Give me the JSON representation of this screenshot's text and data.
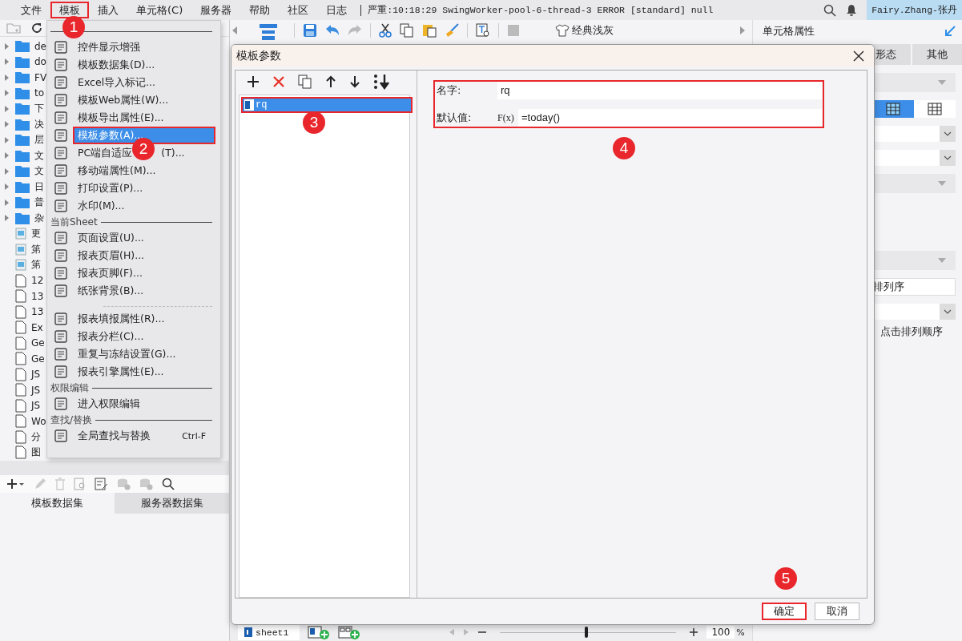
{
  "menubar": {
    "items": [
      {
        "label": "文件"
      },
      {
        "label": "模板",
        "callout": "1"
      },
      {
        "label": "插入"
      },
      {
        "label": "单元格(C)"
      },
      {
        "label": "服务器"
      },
      {
        "label": "帮助"
      },
      {
        "label": "社区"
      },
      {
        "label": "日志"
      }
    ],
    "log": "严重:10:18:29 SwingWorker-pool-6-thread-3 ERROR [standard] null",
    "user": "Fairy.Zhang-张丹"
  },
  "left_panel": {
    "tree": [
      {
        "kind": "folder",
        "label": "de"
      },
      {
        "kind": "folder",
        "label": "do"
      },
      {
        "kind": "folder",
        "label": "FV"
      },
      {
        "kind": "folder",
        "label": "to"
      },
      {
        "kind": "folder",
        "label": "下"
      },
      {
        "kind": "folder",
        "label": "决"
      },
      {
        "kind": "folder",
        "label": "层"
      },
      {
        "kind": "folder",
        "label": "文"
      },
      {
        "kind": "folder",
        "label": "文"
      },
      {
        "kind": "folder",
        "label": "日"
      },
      {
        "kind": "folder",
        "label": "普"
      },
      {
        "kind": "folder",
        "label": "杂"
      },
      {
        "kind": "template",
        "label": "更"
      },
      {
        "kind": "template",
        "label": "第"
      },
      {
        "kind": "template",
        "label": "第"
      },
      {
        "kind": "file",
        "label": "12"
      },
      {
        "kind": "file",
        "label": "13"
      },
      {
        "kind": "file",
        "label": "13"
      },
      {
        "kind": "file",
        "label": "Ex"
      },
      {
        "kind": "file",
        "label": "Ge"
      },
      {
        "kind": "file",
        "label": "Ge"
      },
      {
        "kind": "file",
        "label": "JS"
      },
      {
        "kind": "file",
        "label": "JS"
      },
      {
        "kind": "file",
        "label": "JS"
      },
      {
        "kind": "file",
        "label": "Wo"
      },
      {
        "kind": "file",
        "label": "分"
      },
      {
        "kind": "file",
        "label": "图"
      }
    ],
    "dataset_tabs": [
      {
        "label": "模板数据集",
        "selected": true
      },
      {
        "label": "服务器数据集",
        "selected": false
      }
    ]
  },
  "template_menu": [
    {
      "kind": "section"
    },
    {
      "kind": "item",
      "label": "控件显示增强",
      "selected": false
    },
    {
      "kind": "item",
      "label": "模板数据集(D)...",
      "selected": false
    },
    {
      "kind": "item",
      "label": "Excel导入标记...",
      "selected": false
    },
    {
      "kind": "item",
      "label": "模板Web属性(W)...",
      "selected": false
    },
    {
      "kind": "item",
      "label": "模板导出属性(E)...",
      "selected": false
    },
    {
      "kind": "item",
      "label": "模板参数(A)...",
      "selected": true,
      "callout": "2"
    },
    {
      "kind": "item",
      "label": "PC端自适应",
      "suffix": "(T)...",
      "selected": false
    },
    {
      "kind": "item",
      "label": "移动端属性(M)...",
      "selected": false
    },
    {
      "kind": "item",
      "label": "打印设置(P)...",
      "selected": false
    },
    {
      "kind": "item",
      "label": "水印(M)...",
      "selected": false
    },
    {
      "kind": "section",
      "label": "当前Sheet"
    },
    {
      "kind": "item",
      "label": "页面设置(U)...",
      "selected": false
    },
    {
      "kind": "item",
      "label": "报表页眉(H)...",
      "selected": false
    },
    {
      "kind": "item",
      "label": "报表页脚(F)...",
      "selected": false
    },
    {
      "kind": "item",
      "label": "纸张背景(B)...",
      "selected": false
    },
    {
      "kind": "separator"
    },
    {
      "kind": "item",
      "label": "报表填报属性(R)...",
      "selected": false
    },
    {
      "kind": "item",
      "label": "报表分栏(C)...",
      "selected": false
    },
    {
      "kind": "item",
      "label": "重复与冻结设置(G)...",
      "selected": false
    },
    {
      "kind": "item",
      "label": "报表引擎属性(E)...",
      "selected": false
    },
    {
      "kind": "section",
      "label": "权限编辑"
    },
    {
      "kind": "item",
      "label": "进入权限编辑",
      "selected": false
    },
    {
      "kind": "section",
      "label": "查找/替换"
    },
    {
      "kind": "item",
      "label": "全局查找与替换",
      "shortcut": "Ctrl-F",
      "selected": false
    }
  ],
  "toolbar": {
    "theme": "经典浅灰"
  },
  "right_panel": {
    "title": "单元格属性",
    "tabs": [
      {
        "label": "形态",
        "selected": false
      },
      {
        "label": "其他",
        "selected": false
      }
    ],
    "layout_toggle": [
      {
        "selected": true
      },
      {
        "selected": false
      }
    ],
    "sort_field": "排列序",
    "sort_hint": "点击排列顺序"
  },
  "dialog": {
    "title": "模板参数",
    "parameters": [
      {
        "name": "rq",
        "selected": true,
        "callout": "3"
      }
    ],
    "fields": {
      "callout": "4",
      "name_label": "名字:",
      "name_value": "rq",
      "default_label": "默认值:",
      "formula_button": "F(x)",
      "default_value": "=today()"
    },
    "buttons": [
      {
        "label": "确定",
        "callout": "5"
      },
      {
        "label": "取消"
      }
    ]
  },
  "status_bar": {
    "sheets": [
      {
        "label": "sheet1",
        "selected": true
      }
    ],
    "level": 0.48,
    "zoom": "100",
    "zoom_unit": "%"
  }
}
